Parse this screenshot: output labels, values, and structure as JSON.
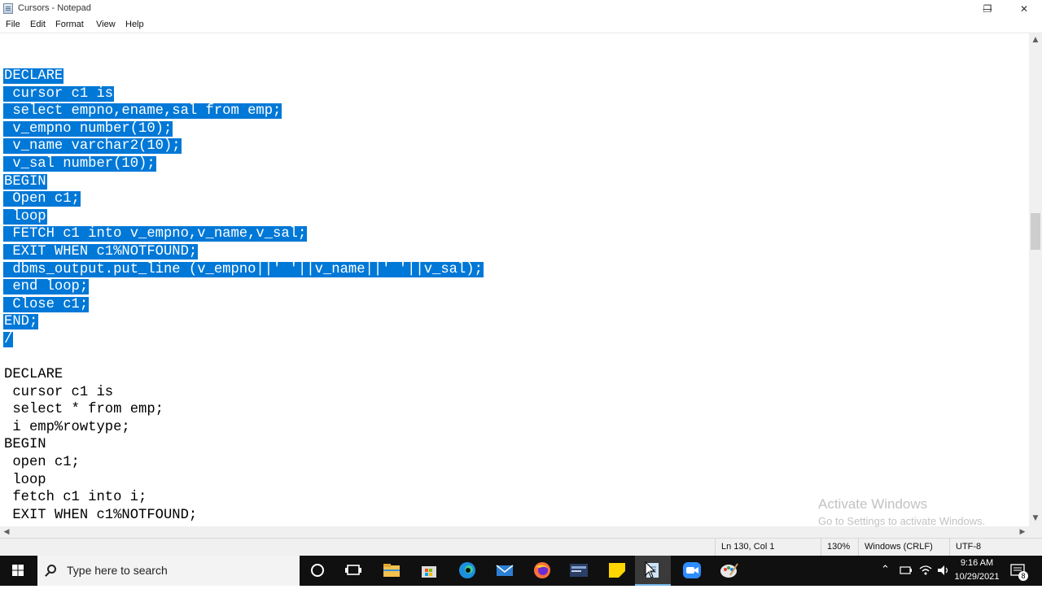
{
  "window": {
    "title": "Cursors - Notepad",
    "minimize_glyph": "—",
    "restore_glyph": "❐",
    "close_glyph": "✕"
  },
  "menu": [
    "File",
    "Edit",
    "Format",
    "View",
    "Help"
  ],
  "editor": {
    "lines": [
      {
        "text": "DECLARE",
        "selected": true
      },
      {
        "text": " cursor c1 is",
        "selected": true
      },
      {
        "text": " select empno,ename,sal from emp;",
        "selected": true
      },
      {
        "text": " v_empno number(10);",
        "selected": true
      },
      {
        "text": " v_name varchar2(10);",
        "selected": true
      },
      {
        "text": " v_sal number(10);",
        "selected": true
      },
      {
        "text": "BEGIN",
        "selected": true
      },
      {
        "text": " Open c1;",
        "selected": true
      },
      {
        "text": " loop",
        "selected": true
      },
      {
        "text": " FETCH c1 into v_empno,v_name,v_sal;",
        "selected": true
      },
      {
        "text": " EXIT WHEN c1%NOTFOUND;",
        "selected": true
      },
      {
        "text": " dbms_output.put_line (v_empno||' '||v_name||' '||v_sal);",
        "selected": true
      },
      {
        "text": " end loop;",
        "selected": true
      },
      {
        "text": " Close c1;",
        "selected": true
      },
      {
        "text": "END;",
        "selected": true
      },
      {
        "text": "/",
        "selected": true
      },
      {
        "text": "",
        "selected": false
      },
      {
        "text": "DECLARE",
        "selected": false
      },
      {
        "text": " cursor c1 is",
        "selected": false
      },
      {
        "text": " select * from emp;",
        "selected": false
      },
      {
        "text": " i emp%rowtype;",
        "selected": false
      },
      {
        "text": "BEGIN",
        "selected": false
      },
      {
        "text": " open c1;",
        "selected": false
      },
      {
        "text": " loop",
        "selected": false
      },
      {
        "text": " fetch c1 into i;",
        "selected": false
      },
      {
        "text": " EXIT WHEN c1%NOTFOUND;",
        "selected": false
      }
    ],
    "selection_color": "#0078d7"
  },
  "status": {
    "position": "Ln 130, Col 1",
    "zoom": "130%",
    "line_ending": "Windows (CRLF)",
    "encoding": "UTF-8"
  },
  "watermark": {
    "title": "Activate Windows",
    "subtitle": "Go to Settings to activate Windows."
  },
  "taskbar": {
    "search_placeholder": "Type here to search",
    "time": "9:16 AM",
    "date": "10/29/2021",
    "notification_count": "8",
    "apps": [
      "cortana-icon",
      "task-view-icon",
      "file-explorer-icon",
      "store-icon",
      "edge-icon",
      "mail-icon",
      "firefox-icon",
      "sql-developer-icon",
      "sticky-notes-icon",
      "notepad-icon",
      "zoom-icon",
      "paint-icon"
    ]
  }
}
